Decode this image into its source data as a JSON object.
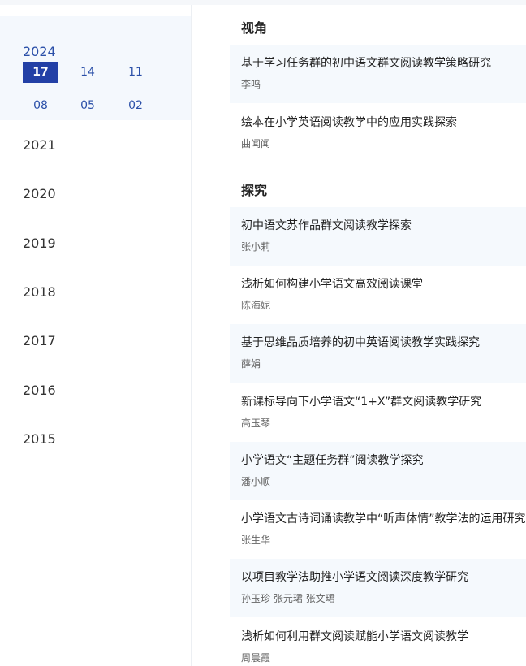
{
  "sidebar": {
    "current_year": "2024",
    "issues": [
      "17",
      "14",
      "11",
      "08",
      "05",
      "02"
    ],
    "active_issue": "17",
    "years": [
      "2021",
      "2020",
      "2019",
      "2018",
      "2017",
      "2016",
      "2015"
    ]
  },
  "sections": [
    {
      "title": "视角",
      "articles": [
        {
          "title": "基于学习任务群的初中语文群文阅读教学策略研究",
          "author": "李鸣"
        },
        {
          "title": "绘本在小学英语阅读教学中的应用实践探索",
          "author": "曲闻闻"
        }
      ]
    },
    {
      "title": "探究",
      "articles": [
        {
          "title": "初中语文苏作品群文阅读教学探索",
          "author": "张小莉"
        },
        {
          "title": "浅析如何构建小学语文高效阅读课堂",
          "author": "陈海妮"
        },
        {
          "title": "基于思维品质培养的初中英语阅读教学实践探究",
          "author": "薛娟"
        },
        {
          "title": "新课标导向下小学语文“1+X”群文阅读教学研究",
          "author": "高玉琴"
        },
        {
          "title": "小学语文“主题任务群”阅读教学探究",
          "author": "潘小顺"
        },
        {
          "title": "小学语文古诗词诵读教学中“听声体情”教学法的运用研究",
          "author": "张生华"
        },
        {
          "title": "以项目教学法助推小学语文阅读深度教学研究",
          "author": "孙玉珍  张元珺  张文珺"
        },
        {
          "title": "浅析如何利用群文阅读赋能小学语文阅读教学",
          "author": "周晨霞"
        }
      ]
    }
  ]
}
